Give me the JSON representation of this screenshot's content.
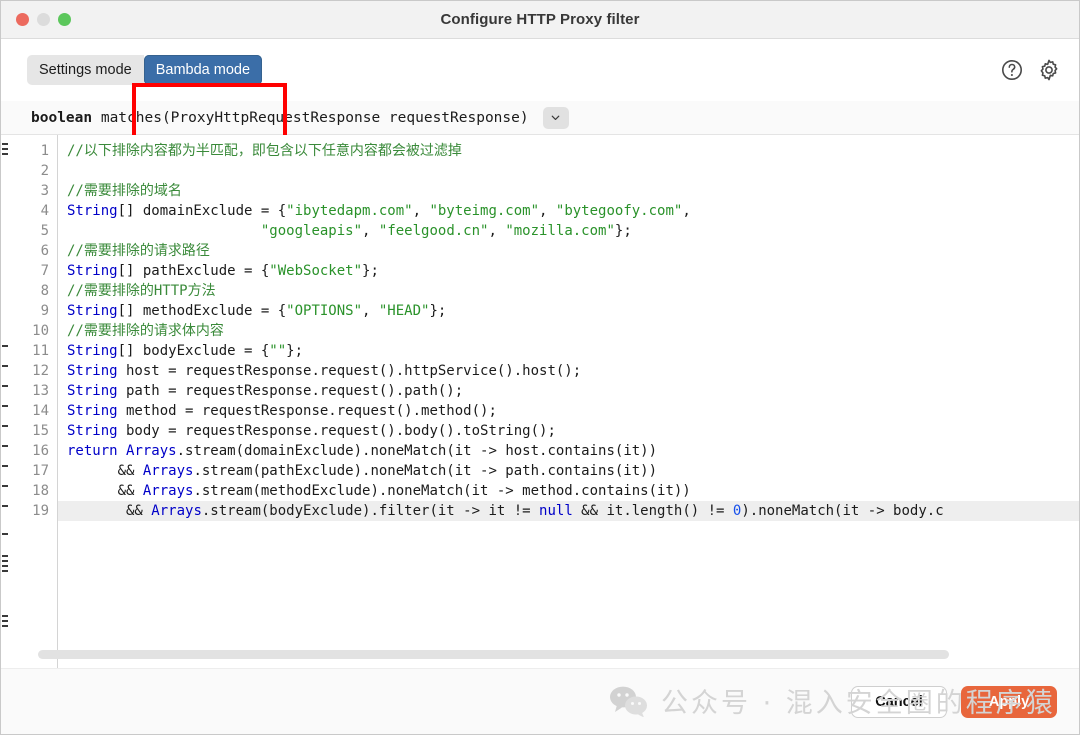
{
  "window": {
    "title": "Configure HTTP Proxy filter",
    "controls": [
      {
        "name": "close-button",
        "color": "#ec6a5e"
      },
      {
        "name": "minimize-button",
        "color": "#dcdcdc"
      },
      {
        "name": "maximize-button",
        "color": "#5cc75c"
      }
    ]
  },
  "toolbar": {
    "tabs": [
      {
        "label": "Settings mode",
        "active": false
      },
      {
        "label": "Bambda mode",
        "active": true
      }
    ],
    "highlight_color": "#ff0000",
    "active_tab_color": "#3b6ea8",
    "icons": [
      {
        "name": "help-icon",
        "title": "Help"
      },
      {
        "name": "gear-icon",
        "title": "Settings"
      }
    ]
  },
  "signature": {
    "return_type": "boolean",
    "text": " matches(ProxyHttpRequestResponse requestResponse)",
    "dropdown": "chevron-down-icon"
  },
  "editor": {
    "line_numbers": [
      "1",
      "2",
      "3",
      "4",
      "5",
      "6",
      "7",
      "8",
      "9",
      "10",
      "11",
      "12",
      "13",
      "14",
      "15",
      "16",
      "17",
      "18",
      "19"
    ],
    "highlighted_line": 19,
    "lines": [
      {
        "n": 1,
        "segments": [
          {
            "t": "//以下排除内容都为半匹配，即包含以下任意内容都会被过滤掉",
            "c": "cm"
          }
        ]
      },
      {
        "n": 2,
        "segments": [
          {
            "t": "",
            "c": ""
          }
        ]
      },
      {
        "n": 3,
        "segments": [
          {
            "t": "//需要排除的域名",
            "c": "cm"
          }
        ]
      },
      {
        "n": 4,
        "segments": [
          {
            "t": "String",
            "c": "k"
          },
          {
            "t": "[] domainExclude = {",
            "c": ""
          },
          {
            "t": "\"ibytedapm.com\"",
            "c": "st"
          },
          {
            "t": ", ",
            "c": ""
          },
          {
            "t": "\"byteimg.com\"",
            "c": "st"
          },
          {
            "t": ", ",
            "c": ""
          },
          {
            "t": "\"bytegoofy.com\"",
            "c": "st"
          },
          {
            "t": ",",
            "c": ""
          }
        ]
      },
      {
        "n": 5,
        "segments": [
          {
            "t": "                       ",
            "c": ""
          },
          {
            "t": "\"googleapis\"",
            "c": "st"
          },
          {
            "t": ", ",
            "c": ""
          },
          {
            "t": "\"feelgood.cn\"",
            "c": "st"
          },
          {
            "t": ", ",
            "c": ""
          },
          {
            "t": "\"mozilla.com\"",
            "c": "st"
          },
          {
            "t": "};",
            "c": ""
          }
        ]
      },
      {
        "n": 6,
        "segments": [
          {
            "t": "//需要排除的请求路径",
            "c": "cm"
          }
        ]
      },
      {
        "n": 7,
        "segments": [
          {
            "t": "String",
            "c": "k"
          },
          {
            "t": "[] pathExclude = {",
            "c": ""
          },
          {
            "t": "\"WebSocket\"",
            "c": "st"
          },
          {
            "t": "};",
            "c": ""
          }
        ]
      },
      {
        "n": 8,
        "segments": [
          {
            "t": "//需要排除的HTTP方法",
            "c": "cm"
          }
        ]
      },
      {
        "n": 9,
        "segments": [
          {
            "t": "String",
            "c": "k"
          },
          {
            "t": "[] methodExclude = {",
            "c": ""
          },
          {
            "t": "\"OPTIONS\"",
            "c": "st"
          },
          {
            "t": ", ",
            "c": ""
          },
          {
            "t": "\"HEAD\"",
            "c": "st"
          },
          {
            "t": "};",
            "c": ""
          }
        ]
      },
      {
        "n": 10,
        "segments": [
          {
            "t": "//需要排除的请求体内容",
            "c": "cm"
          }
        ]
      },
      {
        "n": 11,
        "segments": [
          {
            "t": "String",
            "c": "k"
          },
          {
            "t": "[] bodyExclude = {",
            "c": ""
          },
          {
            "t": "\"\"",
            "c": "st"
          },
          {
            "t": "};",
            "c": ""
          }
        ]
      },
      {
        "n": 12,
        "segments": [
          {
            "t": "String",
            "c": "k"
          },
          {
            "t": " host = requestResponse.request().httpService().host();",
            "c": ""
          }
        ]
      },
      {
        "n": 13,
        "segments": [
          {
            "t": "String",
            "c": "k"
          },
          {
            "t": " path = requestResponse.request().path();",
            "c": ""
          }
        ]
      },
      {
        "n": 14,
        "segments": [
          {
            "t": "String",
            "c": "k"
          },
          {
            "t": " method = requestResponse.request().method();",
            "c": ""
          }
        ]
      },
      {
        "n": 15,
        "segments": [
          {
            "t": "String",
            "c": "k"
          },
          {
            "t": " body = requestResponse.request().body().toString();",
            "c": ""
          }
        ]
      },
      {
        "n": 16,
        "segments": [
          {
            "t": "return",
            "c": "k"
          },
          {
            "t": " ",
            "c": ""
          },
          {
            "t": "Arrays",
            "c": "k"
          },
          {
            "t": ".stream(domainExclude).noneMatch(it -> host.contains(it))",
            "c": ""
          }
        ]
      },
      {
        "n": 17,
        "segments": [
          {
            "t": "      && ",
            "c": ""
          },
          {
            "t": "Arrays",
            "c": "k"
          },
          {
            "t": ".stream(pathExclude).noneMatch(it -> path.contains(it))",
            "c": ""
          }
        ]
      },
      {
        "n": 18,
        "segments": [
          {
            "t": "      && ",
            "c": ""
          },
          {
            "t": "Arrays",
            "c": "k"
          },
          {
            "t": ".stream(methodExclude).noneMatch(it -> method.contains(it))",
            "c": ""
          }
        ]
      },
      {
        "n": 19,
        "segments": [
          {
            "t": "       && ",
            "c": ""
          },
          {
            "t": "Arrays",
            "c": "k"
          },
          {
            "t": ".stream(bodyExclude).filter(it -> it != ",
            "c": ""
          },
          {
            "t": "null",
            "c": "k"
          },
          {
            "t": " && it.length() != ",
            "c": ""
          },
          {
            "t": "0",
            "c": "num"
          },
          {
            "t": ").noneMatch(it -> body.c",
            "c": ""
          }
        ]
      }
    ],
    "scrollbar": {
      "name": "horizontal-scrollbar",
      "orientation": "horizontal"
    }
  },
  "footer": {
    "cancel_label": "Cancel",
    "apply_label": "Apply",
    "apply_color": "#e8663c"
  },
  "watermark": {
    "logo": "wechat-icon",
    "text": "公众号 · 混入安全圈的程序猿"
  }
}
